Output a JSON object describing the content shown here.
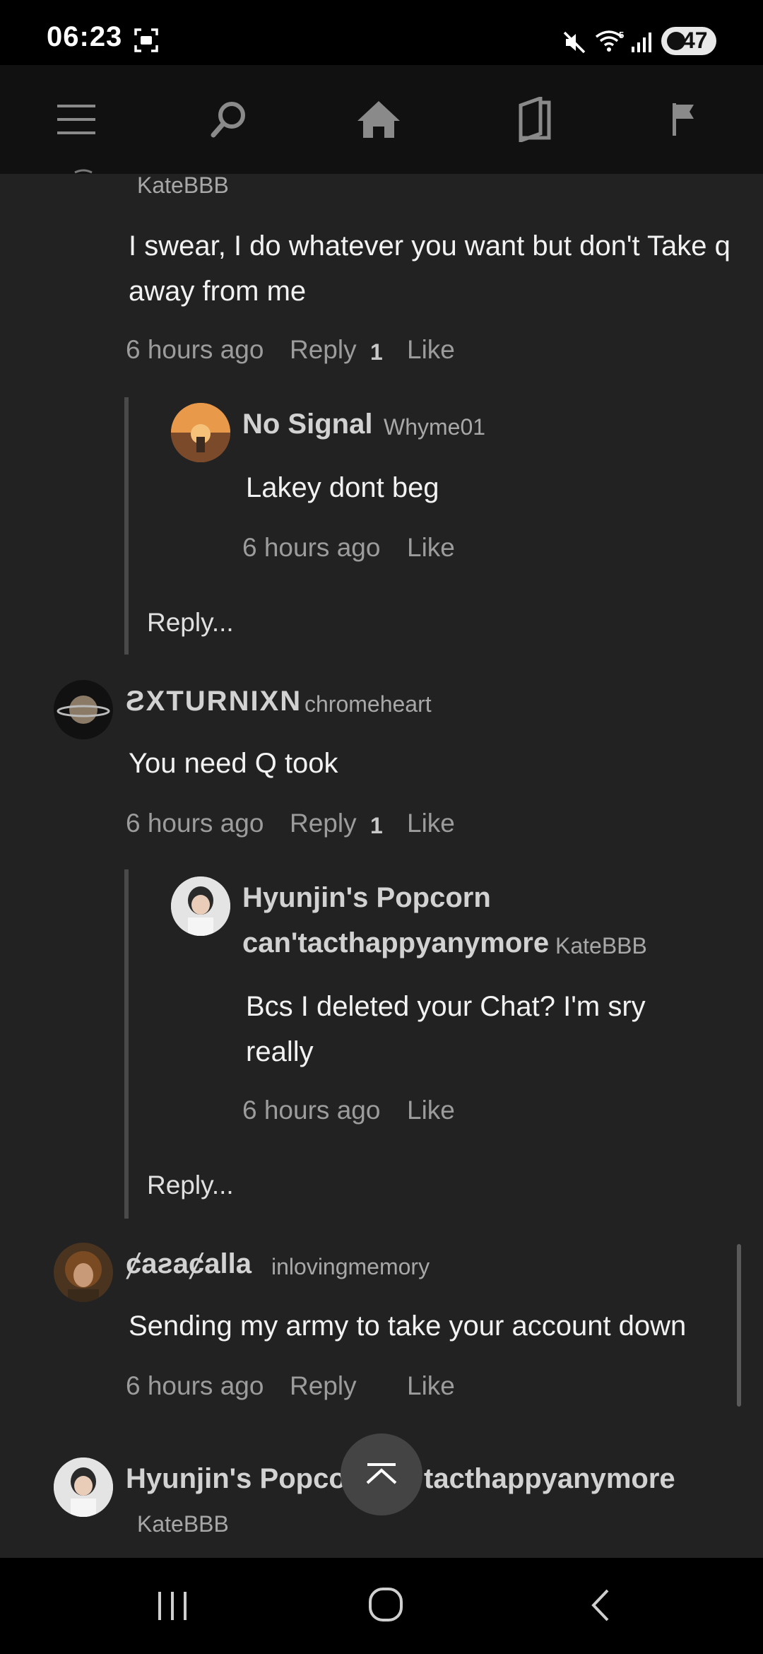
{
  "status_bar": {
    "time": "06:23",
    "battery": "47",
    "icons": [
      "screenshot-icon",
      "mute-icon",
      "wifi-icon",
      "signal-icon",
      "battery-icon"
    ]
  },
  "toolbar": {
    "icons": [
      "menu-icon",
      "search-icon",
      "home-icon",
      "library-icon",
      "flag-icon"
    ]
  },
  "comments": [
    {
      "handle": "KateBBB",
      "text": "I swear, I do whatever you want but don't Take q away from me",
      "time": "6 hours ago",
      "reply_label": "Reply",
      "reply_count": "1",
      "like_label": "Like",
      "replies": [
        {
          "name": "No Signal",
          "handle": "Whyme01",
          "text": "Lakey dont beg",
          "time": "6 hours ago",
          "like_label": "Like"
        }
      ],
      "reply_placeholder": "Reply..."
    },
    {
      "name": "ƧXTURNIXN",
      "handle": "chromeheart",
      "text": "You need Q took",
      "time": "6 hours ago",
      "reply_label": "Reply",
      "reply_count": "1",
      "like_label": "Like",
      "replies": [
        {
          "name_line1": "Hyunjin's Popcorn",
          "name_line2": "can'tacthappyanymore",
          "handle": "KateBBB",
          "text": "Bcs I deleted your Chat? I'm sry really",
          "time": "6 hours ago",
          "like_label": "Like"
        }
      ],
      "reply_placeholder": "Reply..."
    },
    {
      "name": "ȼaƨaȼalla",
      "handle": "inlovingmemory",
      "text": "Sending my army to take your account down",
      "time": "6 hours ago",
      "reply_label": "Reply",
      "like_label": "Like"
    },
    {
      "name_left": "Hyunjin's Popcor",
      "name_right": "tacthappyanymore",
      "handle": "KateBBB"
    }
  ],
  "nav_bar": {
    "icons": [
      "recent-apps-icon",
      "home-circle-icon",
      "back-icon"
    ]
  }
}
